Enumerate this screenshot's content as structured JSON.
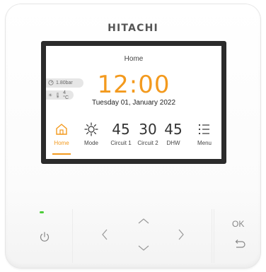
{
  "brand": "HITACHI",
  "screen": {
    "title": "Home",
    "time": "12:00",
    "date": "Tuesday 01, January 2022",
    "status": {
      "pressure": "1.80bar",
      "outdoor_temp": "4 °C"
    }
  },
  "nav": [
    {
      "label": "Home",
      "icon": "home-icon",
      "active": true
    },
    {
      "label": "Mode",
      "icon": "sun-icon"
    },
    {
      "label": "Circuit 1",
      "value": "45"
    },
    {
      "label": "Circuit 2",
      "value": "30"
    },
    {
      "label": "DHW",
      "value": "45"
    },
    {
      "label": "Menu",
      "icon": "menu-icon"
    }
  ],
  "buttons": {
    "ok": "OK"
  },
  "colors": {
    "accent": "#f39a1e",
    "led": "#4ccc3a",
    "bezel": "#2b2b2b"
  }
}
